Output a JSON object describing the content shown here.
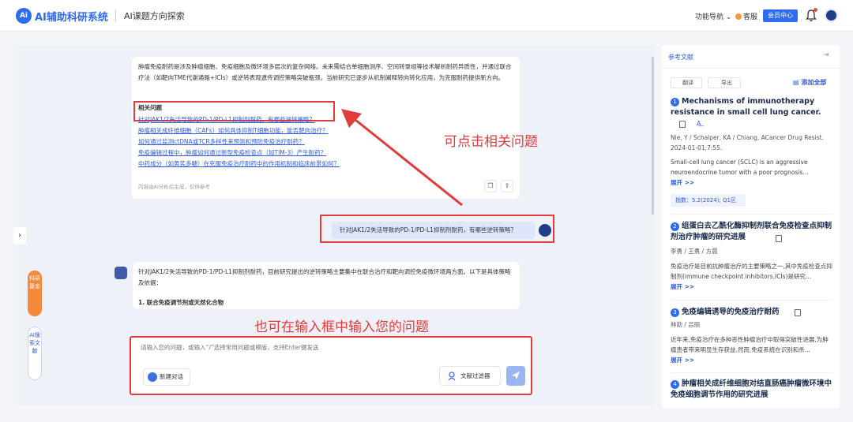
{
  "header": {
    "logo_text": "Ai",
    "brand": "AI辅助科研系统",
    "subtitle": "AI课题方向探索",
    "func_nav": "功能导航",
    "service": "客服",
    "member_center": "会员中心"
  },
  "answer": {
    "paragraph": "肿瘤免疫耐药是涉及肿瘤细胞、免疫细胞及微环境多层次的复杂网络。未来需结合单细胞测序、空间转录组等技术解析耐药异质性，并通过联合疗法（如靶向TME代谢通路+ICIs）或逆转表观遗传调控策略突破瓶颈。当前研究已逐步从机制阐释转向转化应用，为克服耐药提供新方向。",
    "related_title": "相关问题",
    "questions": [
      "针对JAK1/2失活导致的PD-1/PD-L1抑制剂耐药，有哪些逆转策略？",
      "肿瘤相关成纤维细胞（CAFs）如何具体抑制T细胞功能，能否靶向治疗？",
      "如何通过监测ctDNA或TCR多样性来预测和预防免疫治疗耐药？",
      "免疫编辑过程中，肿瘤如何通过新型免疫检查点（如TIM-3）产生耐药？",
      "中药成分（如黄芪多糖）在克服免疫治疗耐药中的作用机制和临床前景如何？"
    ],
    "ai_note": "内容由AI分析后生成，仅供参考"
  },
  "annotations": {
    "clickable_hint": "可点击相关问题",
    "input_hint": "也可在输入框中输入您的问题"
  },
  "user_message": "针对JAK1/2失活导致的PD-1/PD-L1抑制剂耐药，有哪些逆转策略？",
  "bot_reply": {
    "text": "针对JAK1/2失活导致的PD-1/PD-L1抑制剂耐药，目前研究提出的逆转策略主要集中在联合治疗和靶向调控免疫微环境两方面。以下是具体策略及依据：",
    "heading": "1. 联合免疫调节剂或天然化合物"
  },
  "input": {
    "placeholder": "请输入您的问题，或输入“/”选择常用问题或模版，支持Enter键发送",
    "new_chat": "新建对话",
    "filter": "文献过滤器"
  },
  "side_tabs": {
    "research": "科研基金",
    "search": "AI搜索文献"
  },
  "refs": {
    "title": "参考文献",
    "translate": "翻译",
    "export": "导出",
    "add_all": "添加全部",
    "more": "展开 >>",
    "items": [
      {
        "num": "1",
        "title": "Mechanisms of immunotherapy resistance in small cell lung cancer.",
        "authors": "Nie, Y / Schalper, KA / Chiang, ACancer Drug Resist.",
        "date": "2024-01-01;7:55.",
        "abstract": "Small-cell lung cancer (SCLC) is an aggressive neuroendocrine tumor with a poor prognosis...",
        "index": "指数：5.2(2024); Q1区"
      },
      {
        "num": "2",
        "title": "组蛋白去乙酰化酶抑制剂联合免疫检查点抑制剂治疗肿瘤的研究进展",
        "authors": "李勇 / 王勇 / 方晨",
        "abstract": "免疫治疗是目前抗肿瘤治疗的主要策略之一,其中免疫检查点抑制剂(immune checkpoint inhibitors,ICIs)是研究..."
      },
      {
        "num": "3",
        "title": "免疫编辑诱导的免疫治疗耐药",
        "authors": "林劼 / 吕丽",
        "abstract": "近年来,免疫治疗在多种恶性肿瘤治疗中取得突破性进展,为肿瘤患者带来明显生存获益.然而,免疫系统在识别和杀..."
      },
      {
        "num": "4",
        "title": "肿瘤相关成纤维细胞对结直肠癌肿瘤微环境中免疫细胞调节作用的研究进展"
      }
    ]
  }
}
